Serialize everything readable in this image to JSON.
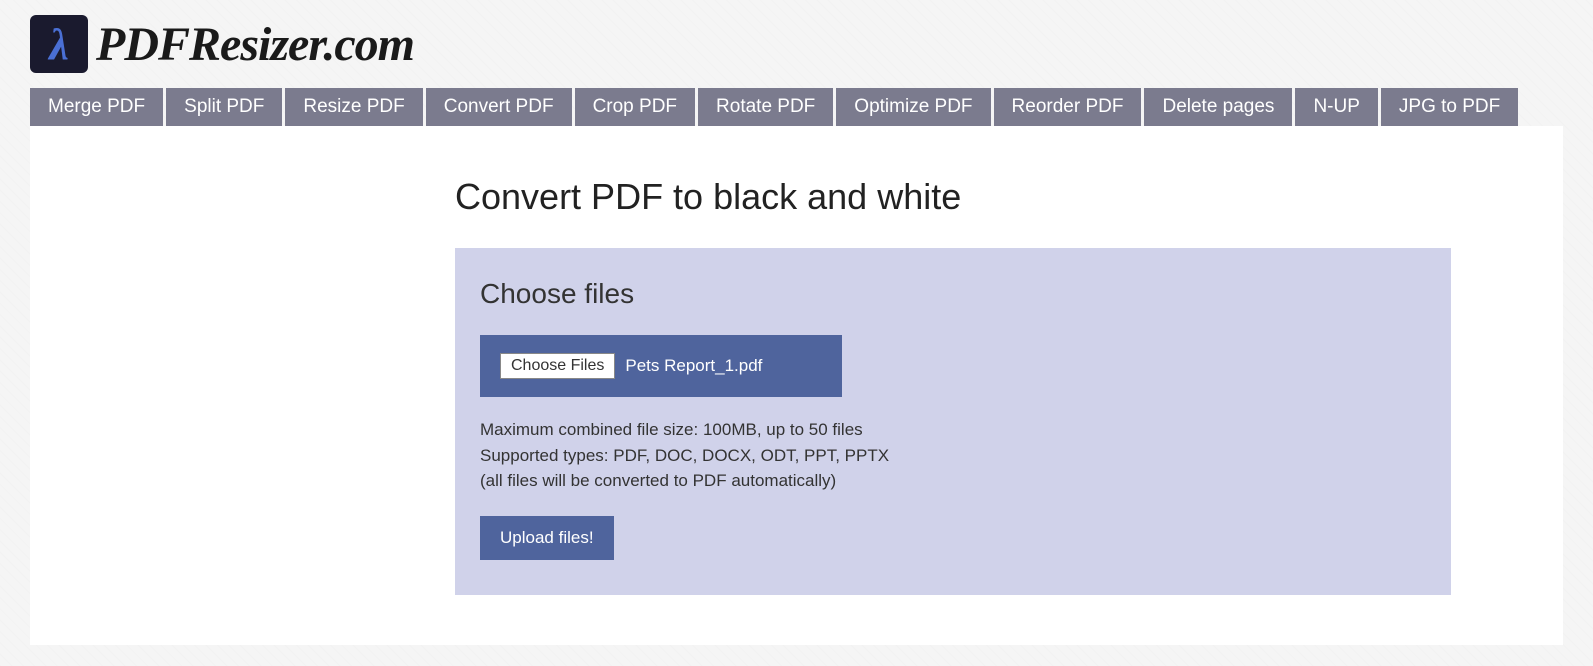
{
  "logo": {
    "text": "PDFResizer.com"
  },
  "nav": {
    "items": [
      "Merge PDF",
      "Split PDF",
      "Resize PDF",
      "Convert PDF",
      "Crop PDF",
      "Rotate PDF",
      "Optimize PDF",
      "Reorder PDF",
      "Delete pages",
      "N-UP",
      "JPG to PDF"
    ]
  },
  "page": {
    "title": "Convert PDF to black and white"
  },
  "upload": {
    "panel_title": "Choose files",
    "choose_button": "Choose Files",
    "selected_file": "Pets Report_1.pdf",
    "info_line1": "Maximum combined file size: 100MB, up to 50 files",
    "info_line2": "Supported types: PDF, DOC, DOCX, ODT, PPT, PPTX",
    "info_line3": "(all files will be converted to PDF automatically)",
    "upload_button": "Upload files!"
  }
}
